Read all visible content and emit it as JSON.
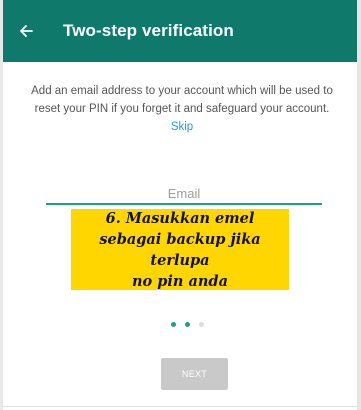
{
  "appbar": {
    "title": "Two-step verification",
    "back_icon": "arrow-left-icon",
    "color": "#0f7a6b"
  },
  "main": {
    "description": "Add an email address to your account which will be used to reset your PIN if you forget it and safeguard your account.",
    "skip_label": "Skip",
    "email_placeholder": "Email",
    "email_value": ""
  },
  "caption": {
    "line1": "6. Masukkan emel",
    "line2": "sebagai backup jika terlupa",
    "line3": "no pin anda",
    "color": "#ffd600"
  },
  "pager": {
    "total": 3,
    "active_indexes": [
      0,
      1
    ]
  },
  "footer": {
    "next_label": "NEXT",
    "next_enabled": false
  },
  "colors": {
    "accent": "#1aa08a",
    "link": "#1e9be8",
    "button_disabled": "#c9c9c9"
  }
}
